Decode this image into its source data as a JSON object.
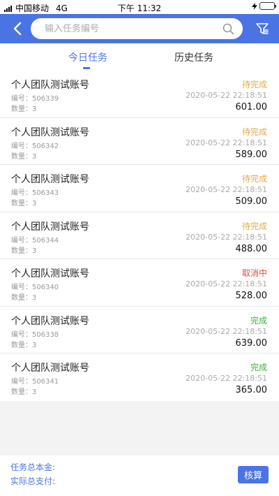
{
  "status_bar": {
    "carrier": "中国移动",
    "network": "4G",
    "time": "下午 11:32"
  },
  "nav": {
    "search_placeholder": "输入任务编号",
    "accent_color": "#4a74e4",
    "back_icon": "chevron-left-icon",
    "search_icon": "search-icon",
    "filter_icon": "filter-icon"
  },
  "tabs": [
    {
      "label": "今日任务",
      "active": true
    },
    {
      "label": "历史任务",
      "active": false
    }
  ],
  "tasks": [
    {
      "name": "个人团队测试账号",
      "number": "编号：506339",
      "quantity": "数量：3",
      "status": "待完成",
      "status_color": "#e2a94a",
      "time": "2020-05-22 22:18:51",
      "amount": "601.00"
    },
    {
      "name": "个人团队测试账号",
      "number": "编号：506342",
      "quantity": "数量：3",
      "status": "待完成",
      "status_color": "#e2a94a",
      "time": "2020-05-22 22:18:51",
      "amount": "589.00"
    },
    {
      "name": "个人团队测试账号",
      "number": "编号：506343",
      "quantity": "数量：3",
      "status": "待完成",
      "status_color": "#e2a94a",
      "time": "2020-05-22 22:18:51",
      "amount": "509.00"
    },
    {
      "name": "个人团队测试账号",
      "number": "编号：506344",
      "quantity": "数量：3",
      "status": "待完成",
      "status_color": "#e2a94a",
      "time": "2020-05-22 22:18:51",
      "amount": "488.00"
    },
    {
      "name": "个人团队测试账号",
      "number": "编号：506340",
      "quantity": "数量：3",
      "status": "取消中",
      "status_color": "#e04b3a",
      "time": "2020-05-22 22:18:51",
      "amount": "528.00"
    },
    {
      "name": "个人团队测试账号",
      "number": "编号：506338",
      "quantity": "数量：3",
      "status": "完成",
      "status_color": "#3fae3f",
      "time": "2020-05-22 22:18:51",
      "amount": "639.00"
    },
    {
      "name": "个人团队测试账号",
      "number": "编号：506341",
      "quantity": "数量：3",
      "status": "完成",
      "status_color": "#3fae3f",
      "time": "2020-05-22 22:18:51",
      "amount": "365.00"
    }
  ],
  "footer": {
    "total_principal_label": "任务总本金:",
    "actual_paid_label": "实际总支付:",
    "verify_button": "核算"
  }
}
